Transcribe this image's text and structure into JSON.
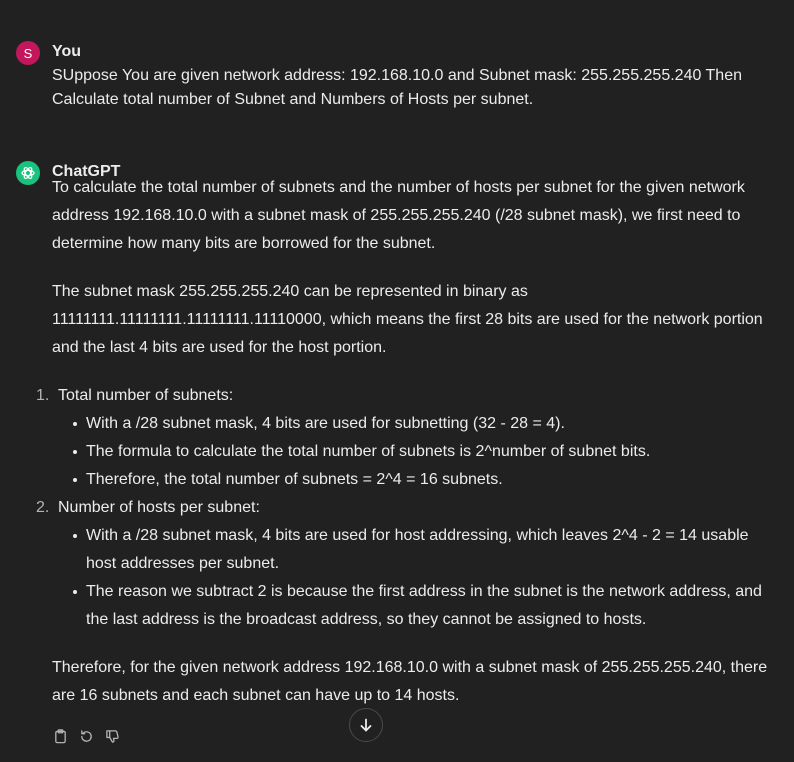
{
  "user_message": {
    "avatar_letter": "S",
    "author": "You",
    "text": "SUppose You are given network address: 192.168.10.0 and Subnet mask: 255.255.255.240 Then Calculate total number of Subnet and Numbers of Hosts per subnet."
  },
  "assistant_message": {
    "author": "ChatGPT",
    "para1": "To calculate the total number of subnets and the number of hosts per subnet for the given network address 192.168.10.0 with a subnet mask of 255.255.255.240 (/28 subnet mask), we first need to determine how many bits are borrowed for the subnet.",
    "para2": "The subnet mask 255.255.255.240 can be represented in binary as 11111111.11111111.11111111.11110000, which means the first 28 bits are used for the network portion and the last 4 bits are used for the host portion.",
    "list": [
      {
        "number": "1.",
        "title": "Total number of subnets:",
        "bullets": [
          "With a /28 subnet mask, 4 bits are used for subnetting (32 - 28 = 4).",
          "The formula to calculate the total number of subnets is 2^number of subnet bits.",
          "Therefore, the total number of subnets = 2^4 = 16 subnets."
        ]
      },
      {
        "number": "2.",
        "title": "Number of hosts per subnet:",
        "bullets": [
          "With a /28 subnet mask, 4 bits are used for host addressing, which leaves 2^4 - 2 = 14 usable host addresses per subnet.",
          "The reason we subtract 2 is because the first address in the subnet is the network address, and the last address is the broadcast address, so they cannot be assigned to hosts."
        ]
      }
    ],
    "conclusion": "Therefore, for the given network address 192.168.10.0 with a subnet mask of 255.255.255.240, there are 16 subnets and each subnet can have up to 14 hosts."
  },
  "icons": {
    "copy": "clipboard-icon",
    "regenerate": "regenerate-icon",
    "dislike": "thumbs-down-icon",
    "scroll": "arrow-down-icon"
  },
  "colors": {
    "background": "#212121",
    "text": "#ececec",
    "user_avatar": "#c2185b",
    "assistant_avatar": "#19c37d"
  }
}
